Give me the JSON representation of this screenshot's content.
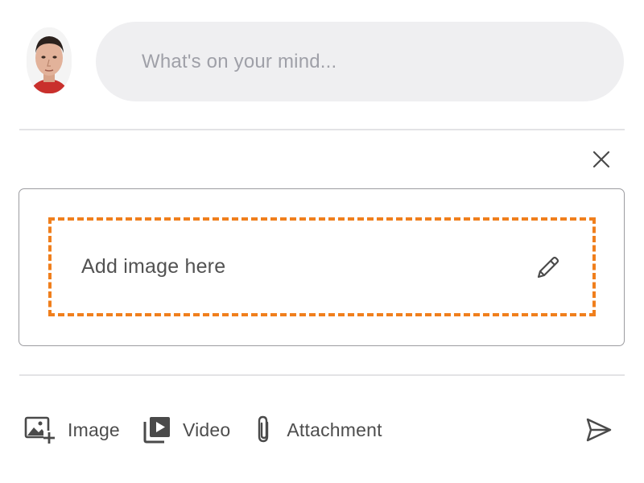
{
  "composer": {
    "placeholder": "What's on your mind..."
  },
  "upload_card": {
    "drop_label": "Add image here",
    "accent_color": "#f07f1d"
  },
  "toolbar": {
    "items": [
      {
        "label": "Image",
        "icon": "add-image-icon"
      },
      {
        "label": "Video",
        "icon": "video-library-icon"
      },
      {
        "label": "Attachment",
        "icon": "paperclip-icon"
      }
    ],
    "send_icon": "send-icon"
  },
  "icons": {
    "close": "close-icon",
    "edit": "pencil-icon"
  },
  "colors": {
    "input_bg": "#efeff1",
    "divider": "#e3e3e5",
    "text": "#4d4d4d",
    "placeholder": "#9fa0a8"
  }
}
